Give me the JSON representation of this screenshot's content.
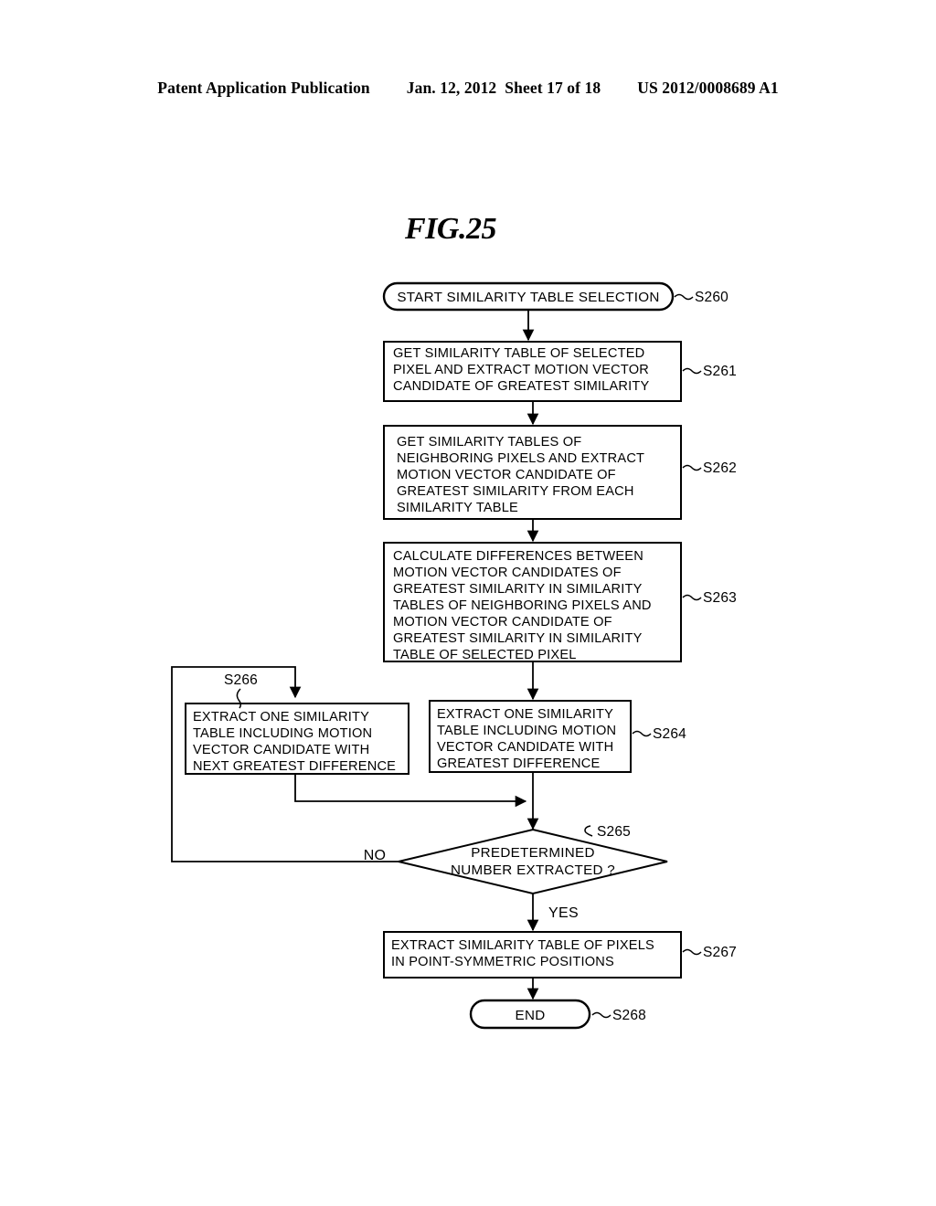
{
  "header": {
    "publication": "Patent Application Publication",
    "date": "Jan. 12, 2012",
    "sheet": "Sheet 17 of 18",
    "number": "US 2012/0008689 A1"
  },
  "figure": {
    "title": "FIG.25"
  },
  "flowchart": {
    "start": {
      "label": "START SIMILARITY TABLE SELECTION",
      "step": "S260"
    },
    "s261": {
      "step": "S261",
      "lines": [
        "GET SIMILARITY TABLE OF SELECTED",
        "PIXEL AND EXTRACT MOTION VECTOR",
        "CANDIDATE OF GREATEST SIMILARITY"
      ]
    },
    "s262": {
      "step": "S262",
      "lines": [
        "GET SIMILARITY TABLES OF",
        "NEIGHBORING PIXELS AND EXTRACT",
        "MOTION VECTOR CANDIDATE OF",
        "GREATEST SIMILARITY FROM EACH",
        "SIMILARITY TABLE"
      ]
    },
    "s263": {
      "step": "S263",
      "lines": [
        "CALCULATE DIFFERENCES BETWEEN",
        "MOTION VECTOR CANDIDATES OF",
        "GREATEST SIMILARITY IN SIMILARITY",
        "TABLES OF NEIGHBORING PIXELS AND",
        "MOTION VECTOR CANDIDATE OF",
        "GREATEST SIMILARITY IN SIMILARITY",
        "TABLE OF SELECTED PIXEL"
      ]
    },
    "s266": {
      "step": "S266",
      "lines": [
        "EXTRACT ONE SIMILARITY",
        "TABLE INCLUDING MOTION",
        "VECTOR CANDIDATE WITH",
        "NEXT GREATEST DIFFERENCE"
      ]
    },
    "s264": {
      "step": "S264",
      "lines": [
        "EXTRACT ONE SIMILARITY",
        "TABLE INCLUDING MOTION",
        "VECTOR CANDIDATE WITH",
        "GREATEST DIFFERENCE"
      ]
    },
    "s265": {
      "step": "S265",
      "lines": [
        "PREDETERMINED",
        "NUMBER EXTRACTED ?"
      ],
      "branch_no": "NO",
      "branch_yes": "YES"
    },
    "s267": {
      "step": "S267",
      "lines": [
        "EXTRACT SIMILARITY TABLE OF PIXELS",
        "IN POINT-SYMMETRIC POSITIONS"
      ]
    },
    "end": {
      "label": "END",
      "step": "S268"
    }
  },
  "colors": {
    "ink": "#000000",
    "paper": "#ffffff"
  }
}
